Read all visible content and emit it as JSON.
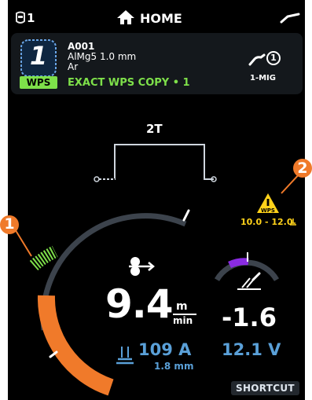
{
  "topbar": {
    "left_icon": "welder-mask-icon",
    "left_count": "1",
    "title": "HOME",
    "home_icon": "home-icon",
    "right_icon": "torch-icon"
  },
  "wps": {
    "number": "1",
    "badge": "WPS",
    "id": "A001",
    "material": "AlMg5 1.0 mm",
    "gas": "Ar",
    "status": "EXACT WPS COPY • 1",
    "process": "1-MIG",
    "process_channel": "1",
    "process_icon": "mig-torch-icon"
  },
  "trigger": {
    "mode": "2T"
  },
  "warning": {
    "icon": "warning-triangle-icon",
    "badge": "WPS",
    "range": "10.0 - 12.0"
  },
  "main": {
    "wire_feed_icon": "wire-feed-icon",
    "wire_speed": "9.4",
    "unit_numerator": "m",
    "unit_denominator": "min",
    "trim": "-1.6",
    "trim_icon": "arc-length-icon",
    "current": "109 A",
    "thickness": "1.8 mm",
    "thickness_icon": "plate-thickness-icon",
    "voltage": "12.1 V"
  },
  "markers": [
    "1",
    "2"
  ],
  "shortcut_label": "SHORTCUT",
  "colors": {
    "orange": "#f07a2a",
    "green": "#7ee04a",
    "blue": "#5aa0d8",
    "purple": "#8a2be2",
    "yellow": "#ffd21a",
    "arc_gray": "#3c434c"
  }
}
